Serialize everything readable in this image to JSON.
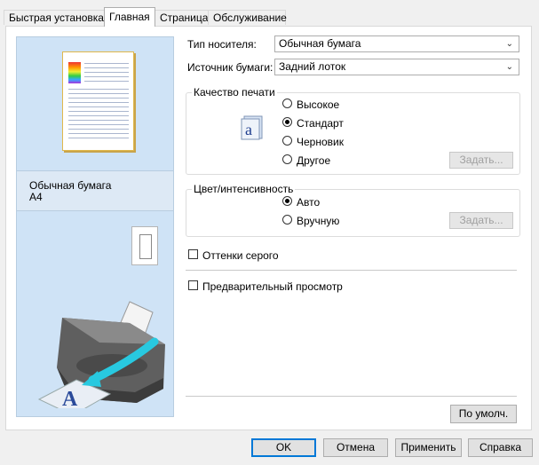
{
  "tabs": [
    {
      "label": "Быстрая установка",
      "active": false
    },
    {
      "label": "Главная",
      "active": true
    },
    {
      "label": "Страница",
      "active": false
    },
    {
      "label": "Обслуживание",
      "active": false
    }
  ],
  "preview": {
    "media_line": "Обычная бумага",
    "size_line": "A4"
  },
  "settings": {
    "media_type_label": "Тип носителя:",
    "media_type_value": "Обычная бумага",
    "paper_source_label": "Источник бумаги:",
    "paper_source_value": "Задний лоток"
  },
  "quality": {
    "legend": "Качество печати",
    "options": [
      {
        "label": "Высокое",
        "selected": false
      },
      {
        "label": "Стандарт",
        "selected": true
      },
      {
        "label": "Черновик",
        "selected": false
      },
      {
        "label": "Другое",
        "selected": false
      }
    ],
    "set_button": "Задать..."
  },
  "color": {
    "legend": "Цвет/интенсивность",
    "options": [
      {
        "label": "Авто",
        "selected": true
      },
      {
        "label": "Вручную",
        "selected": false
      }
    ],
    "set_button": "Задать..."
  },
  "grayscale": {
    "label": "Оттенки серого",
    "checked": false
  },
  "preview_option": {
    "label": "Предварительный просмотр",
    "checked": false
  },
  "defaults_button": "По умолч.",
  "footer": {
    "ok": "OK",
    "cancel": "Отмена",
    "apply": "Применить",
    "help": "Справка"
  },
  "colors": {
    "accent": "#0078d7",
    "preview_bg": "#cfe3f6"
  }
}
